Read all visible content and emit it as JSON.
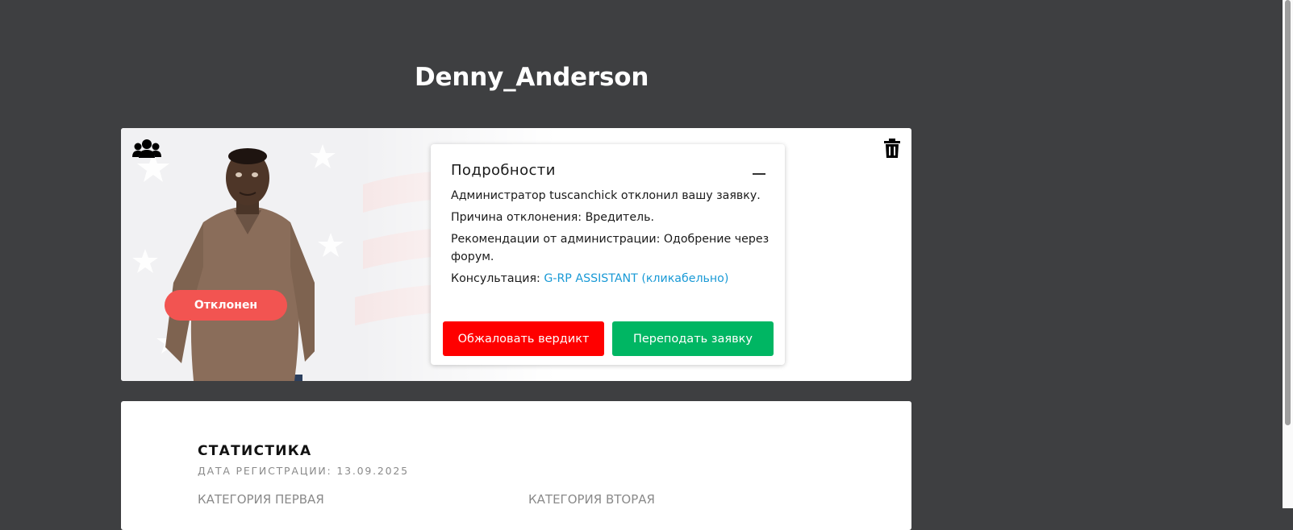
{
  "page": {
    "title": "Denny_Anderson"
  },
  "character_card": {
    "group_icon": "users-icon",
    "delete_icon": "trash-icon",
    "status": "Отклонен",
    "status_color": "#f25451"
  },
  "details": {
    "title": "Подробности",
    "collapse_icon": "minus-icon",
    "line1": "Администратор tuscanchick отклонил вашу заявку.",
    "line2": "Причина отклонения: Вредитель.",
    "line3": "Рекомендации от администрации: Одобрение через форум.",
    "consult_label": "Консультация:",
    "consult_link": "G-RP ASSISTANT (кликабельно)",
    "link_color": "#1a9ad6",
    "appeal_button": "Обжаловать вердикт",
    "appeal_color": "#ff0000",
    "resubmit_button": "Переподать заявку",
    "resubmit_color": "#00b663"
  },
  "stats": {
    "title": "СТАТИСТИКА",
    "registration": "ДАТА РЕГИСТРАЦИИ: 13.09.2025",
    "category1": "КАТЕГОРИЯ ПЕРВАЯ",
    "category2": "КАТЕГОРИЯ ВТОРАЯ"
  }
}
